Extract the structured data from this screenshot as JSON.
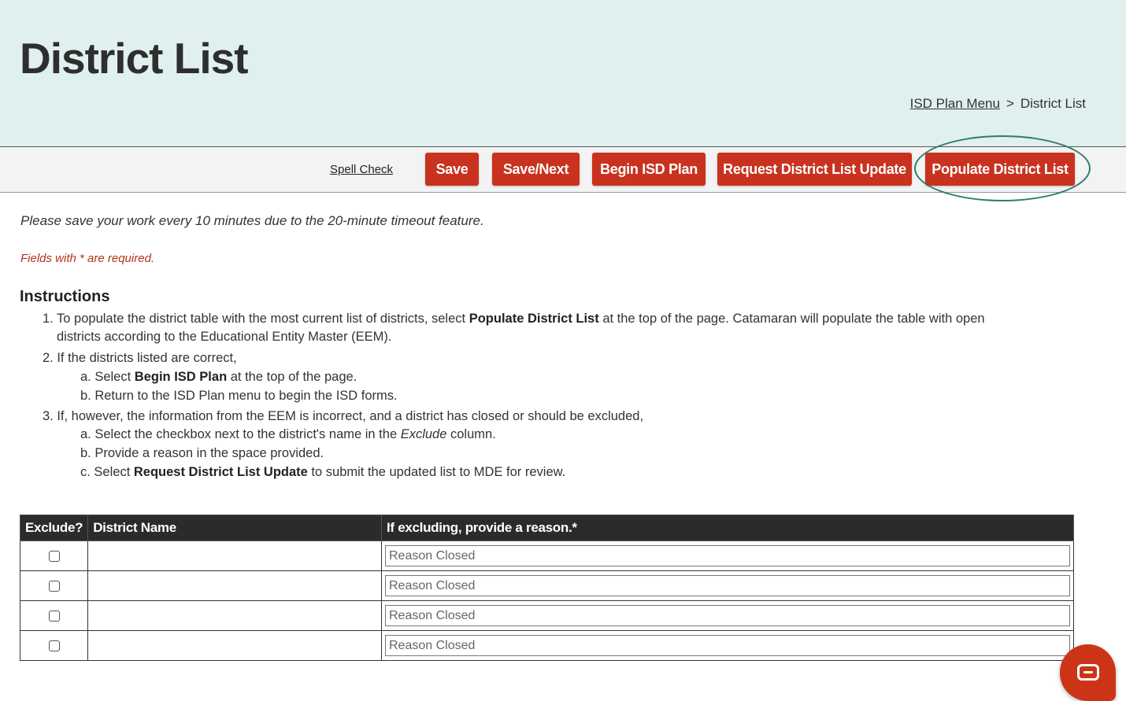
{
  "header": {
    "title": "District List",
    "breadcrumb": {
      "link": "ISD Plan Menu",
      "separator": ">",
      "current": "District List"
    }
  },
  "toolbar": {
    "spell_check": "Spell Check",
    "save": "Save",
    "save_next": "Save/Next",
    "begin_isd_plan": "Begin ISD Plan",
    "request_update": "Request District List Update",
    "populate": "Populate District List",
    "button_color": "#c9321f",
    "highlight_color": "#2e7d6b"
  },
  "notice": "Please save your work every 10 minutes due to the 20-minute timeout feature.",
  "required_note": "Fields with * are required.",
  "instructions": {
    "title": "Instructions",
    "s1_pre": "1. To populate the district table with the most current list of districts, select ",
    "s1_bold": "Populate District List",
    "s1_post": " at the top of the page. Catamaran will populate the table with open",
    "s1_cont": "districts according to the Educational Entity Master (EEM).",
    "s2": "2. If the districts listed are correct,",
    "s2a_pre": "a. Select ",
    "s2a_bold": "Begin ISD Plan",
    "s2a_post": " at the top of the page.",
    "s2b": "b. Return to the ISD Plan menu to begin the ISD forms.",
    "s3": "3. If, however, the information from the EEM is incorrect, and a district has closed or should be excluded,",
    "s3a_pre": "a. Select the checkbox next to the district's name in the ",
    "s3a_italic": "Exclude",
    "s3a_post": " column.",
    "s3b": "b. Provide a reason in the space provided.",
    "s3c_pre": "c. Select ",
    "s3c_bold": "Request District List Update",
    "s3c_post": " to submit the updated list to MDE for review."
  },
  "table": {
    "headers": [
      "Exclude?",
      "District Name",
      "If excluding, provide a reason.*"
    ],
    "rows": [
      {
        "excluded": false,
        "district": "",
        "reason_placeholder": "Reason Closed"
      },
      {
        "excluded": false,
        "district": "",
        "reason_placeholder": "Reason Closed"
      },
      {
        "excluded": false,
        "district": "",
        "reason_placeholder": "Reason Closed"
      },
      {
        "excluded": false,
        "district": "",
        "reason_placeholder": "Reason Closed"
      }
    ]
  },
  "chat_widget": {
    "icon": "chat-icon"
  }
}
